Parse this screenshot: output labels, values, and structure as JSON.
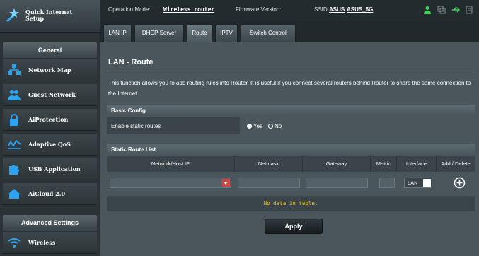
{
  "sidebar": {
    "quick_setup": "Quick Internet Setup",
    "general_header": "General",
    "items": [
      {
        "label": "Network Map",
        "icon": "network-map-icon"
      },
      {
        "label": "Guest Network",
        "icon": "guest-network-icon"
      },
      {
        "label": "AiProtection",
        "icon": "lock-icon"
      },
      {
        "label": "Adaptive QoS",
        "icon": "qos-icon"
      },
      {
        "label": "USB Application",
        "icon": "puzzle-icon"
      },
      {
        "label": "AiCloud 2.0",
        "icon": "cloud-icon"
      }
    ],
    "advanced_header": "Advanced Settings",
    "advanced_items": [
      {
        "label": "Wireless",
        "icon": "wifi-icon"
      }
    ]
  },
  "topbar": {
    "mode_label": "Operation Mode:",
    "mode_value": "Wireless router",
    "firmware_label": "Firmware Version:",
    "ssid_label": "SSID:",
    "ssid_1": "ASUS",
    "ssid_2": "ASUS_5G",
    "icons": [
      "user-icon",
      "copy-icon",
      "usb-icon",
      "printer-icon"
    ]
  },
  "tabs": [
    "LAN IP",
    "DHCP Server",
    "Route",
    "IPTV",
    "Switch Control"
  ],
  "active_tab": "Route",
  "page": {
    "title": "LAN - Route",
    "description": "This function allows you to add routing rules into Router. It is useful if you connect several routers behind Router to share the same connection to the Internet.",
    "basic_config": "Basic Config",
    "enable_label": "Enable static routes",
    "yes": "Yes",
    "no": "No",
    "static_list": "Static Route List",
    "columns": [
      "Network/Host IP",
      "Netmask",
      "Gateway",
      "Metric",
      "Interface",
      "Add / Delete"
    ],
    "interface_value": "LAN",
    "empty_text": "No data in table.",
    "apply": "Apply"
  },
  "colors": {
    "accent_red": "#d64545",
    "empty_text": "#f0c419",
    "panel": "#4a565c"
  }
}
